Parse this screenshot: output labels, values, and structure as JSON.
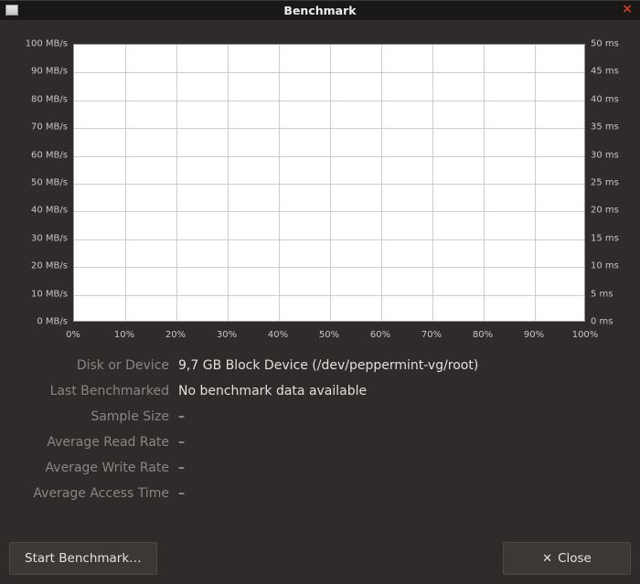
{
  "window": {
    "title": "Benchmark"
  },
  "chart_data": {
    "type": "line",
    "x": [],
    "series": [],
    "y_left_ticks": [
      "100 MB/s",
      "90 MB/s",
      "80 MB/s",
      "70 MB/s",
      "60 MB/s",
      "50 MB/s",
      "40 MB/s",
      "30 MB/s",
      "20 MB/s",
      "10 MB/s",
      "0 MB/s"
    ],
    "y_right_ticks": [
      "50 ms",
      "45 ms",
      "40 ms",
      "35 ms",
      "30 ms",
      "25 ms",
      "20 ms",
      "15 ms",
      "10 ms",
      "5 ms",
      "0 ms"
    ],
    "x_ticks": [
      "0%",
      "10%",
      "20%",
      "30%",
      "40%",
      "50%",
      "60%",
      "70%",
      "80%",
      "90%",
      "100%"
    ],
    "xlim": [
      0,
      100
    ],
    "ylim_left": [
      0,
      100
    ],
    "ylim_right": [
      0,
      50
    ]
  },
  "info": {
    "rows": [
      {
        "label": "Disk or Device",
        "value": "9,7 GB Block Device (/dev/peppermint-vg/root)"
      },
      {
        "label": "Last Benchmarked",
        "value": "No benchmark data available"
      },
      {
        "label": "Sample Size",
        "value": "–"
      },
      {
        "label": "Average Read Rate",
        "value": "–"
      },
      {
        "label": "Average Write Rate",
        "value": "–"
      },
      {
        "label": "Average Access Time",
        "value": "–"
      }
    ]
  },
  "buttons": {
    "start": "Start Benchmark…",
    "close": "Close"
  }
}
